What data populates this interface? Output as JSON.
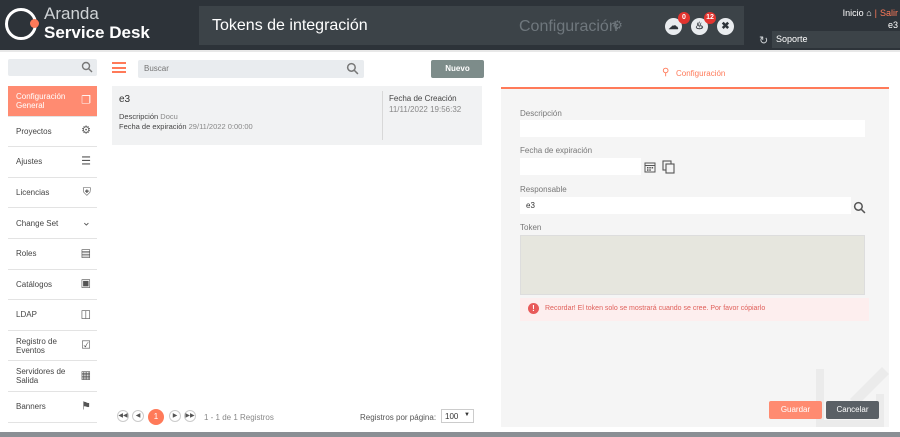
{
  "brand": {
    "line1": "Aranda",
    "line2": "Service Desk"
  },
  "header": {
    "title": "Tokens de integración",
    "config_label": "Configuración",
    "upload_badge": "0",
    "notifications_badge": "12",
    "home_link": "Inicio",
    "logout_link": "Salir",
    "user": "e3",
    "support_select": "Soporte"
  },
  "sidebar": {
    "items": [
      {
        "label": "Configuración General",
        "icon": "copy-icon"
      },
      {
        "label": "Proyectos",
        "icon": "gear-icon"
      },
      {
        "label": "Ajustes",
        "icon": "sliders-icon"
      },
      {
        "label": "Licencias",
        "icon": "shield-icon"
      },
      {
        "label": "Change Set",
        "icon": "chevron-down-icon"
      },
      {
        "label": "Roles",
        "icon": "id-badge-icon"
      },
      {
        "label": "Catálogos",
        "icon": "catalog-icon"
      },
      {
        "label": "LDAP",
        "icon": "folder-icon"
      },
      {
        "label": "Registro de Eventos",
        "icon": "clipboard-icon"
      },
      {
        "label": "Servidores de Salida",
        "icon": "server-icon"
      },
      {
        "label": "Banners",
        "icon": "flag-icon"
      }
    ]
  },
  "list": {
    "search_placeholder": "Buscar",
    "new_button": "Nuevo",
    "records": [
      {
        "name": "e3",
        "description_label": "Descripción",
        "description": "Docu",
        "expiration_label": "Fecha de expiración",
        "expiration": "29/11/2022 0:00:00",
        "created_label": "Fecha de Creación",
        "created": "11/11/2022 19:56:32"
      }
    ]
  },
  "pagination": {
    "current": "1",
    "info": "1 - 1 de 1 Registros",
    "per_page_label": "Registros por página:",
    "per_page": "100"
  },
  "form": {
    "tab_label": "Configuración",
    "description_label": "Descripción",
    "description_value": "",
    "expiration_label": "Fecha de expiración",
    "expiration_value": "",
    "responsible_label": "Responsable",
    "responsible_value": "e3",
    "token_label": "Token",
    "token_value": "",
    "alert": "Recordar! El token solo se mostrará cuando se cree. Por favor cópiarlo",
    "save": "Guardar",
    "cancel": "Cancelar"
  },
  "colors": {
    "accent": "#ff7a59",
    "header": "#2d3339",
    "new_button": "#7d8c8a",
    "cancel_button": "#5a6066"
  }
}
